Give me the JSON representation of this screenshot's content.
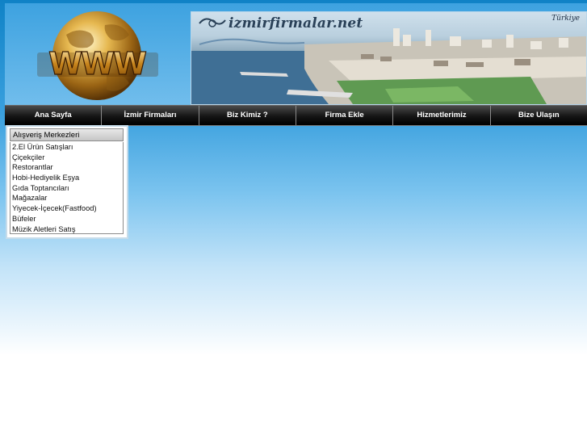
{
  "header": {
    "logo_icon": "www-globe-icon",
    "banner_title": "izmirfirmalar.net",
    "banner_brand": "Türkiye"
  },
  "nav": {
    "items": [
      {
        "label": "Ana Sayfa"
      },
      {
        "label": "İzmir Firmaları"
      },
      {
        "label": "Biz Kimiz ?"
      },
      {
        "label": "Firma Ekle"
      },
      {
        "label": "Hizmetlerimiz"
      },
      {
        "label": "Bize Ulaşın"
      }
    ]
  },
  "categories": {
    "title": "Alışveriş Merkezleri",
    "items": [
      "2.El Ürün Satışları",
      "Çiçekçiler",
      "Restorantlar",
      "Hobi-Hediyelik Eşya",
      "Gıda Toptancıları",
      "Mağazalar",
      "Yiyecek-İçecek(Fastfood)",
      "Büfeler",
      "Müzik Aletleri Satış"
    ]
  },
  "colors": {
    "sky_top": "#0f82c6",
    "nav_bg": "#141414",
    "nav_text": "#ffffff"
  }
}
